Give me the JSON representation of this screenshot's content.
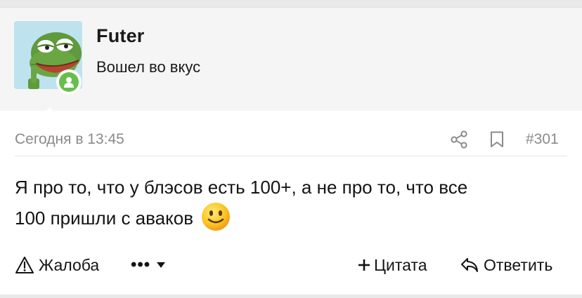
{
  "user": {
    "name": "Futer",
    "title": "Вошел во вкус",
    "status": "online"
  },
  "post": {
    "date": "Сегодня в 13:45",
    "number": "#301",
    "text_line1": "Я про то, что у блэсов есть 100+, а не про то, что все",
    "text_line2": "100 пришли с аваков",
    "emoji": "slightly-smiling-face"
  },
  "actions": {
    "report_label": "Жалоба",
    "more_label": "•••",
    "quote_label": "Цитата",
    "reply_label": "Ответить"
  },
  "colors": {
    "online": "#67bd4d",
    "muted_text": "#8a8a8a",
    "card_bg": "#f5f5f5",
    "page_bg": "#e9e9e9"
  }
}
